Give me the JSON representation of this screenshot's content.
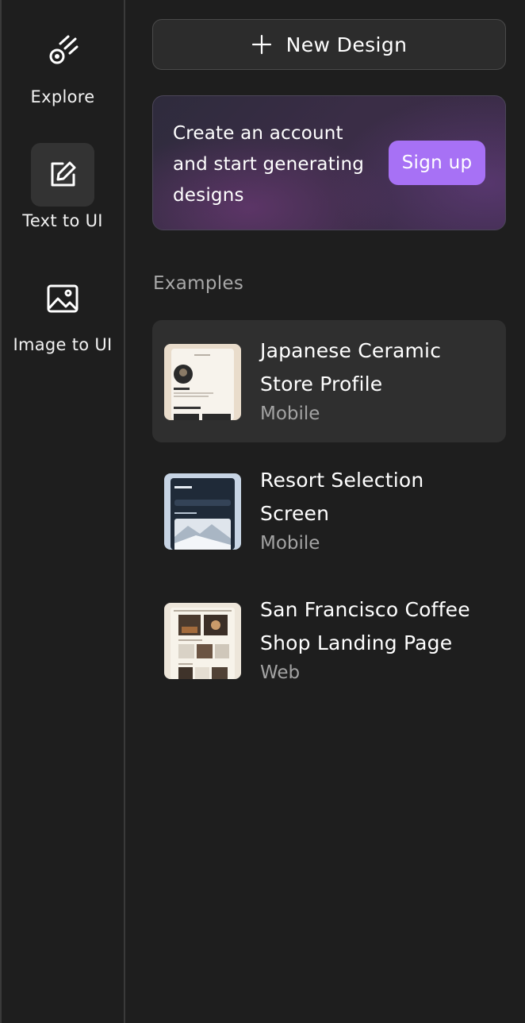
{
  "rail": {
    "items": [
      {
        "label": "Explore",
        "icon": "comet-icon",
        "active": false
      },
      {
        "label": "Text to UI",
        "icon": "edit-icon",
        "active": true
      },
      {
        "label": "Image to UI",
        "icon": "image-icon",
        "active": false
      }
    ]
  },
  "main": {
    "new_design_label": "New Design",
    "promo": {
      "text": "Create an account and start generating designs",
      "signup_label": "Sign up"
    },
    "examples_title": "Examples",
    "examples": [
      {
        "title": "Japanese Ceramic Store Profile",
        "type": "Mobile"
      },
      {
        "title": "Resort Selection Screen",
        "type": "Mobile"
      },
      {
        "title": "San Francisco Coffee Shop Landing Page",
        "type": "Web"
      }
    ]
  },
  "colors": {
    "background": "#1e1e1e",
    "accent": "#a771f5",
    "selected_item": "#2f2f2f",
    "muted_text": "#a3a3a3"
  }
}
